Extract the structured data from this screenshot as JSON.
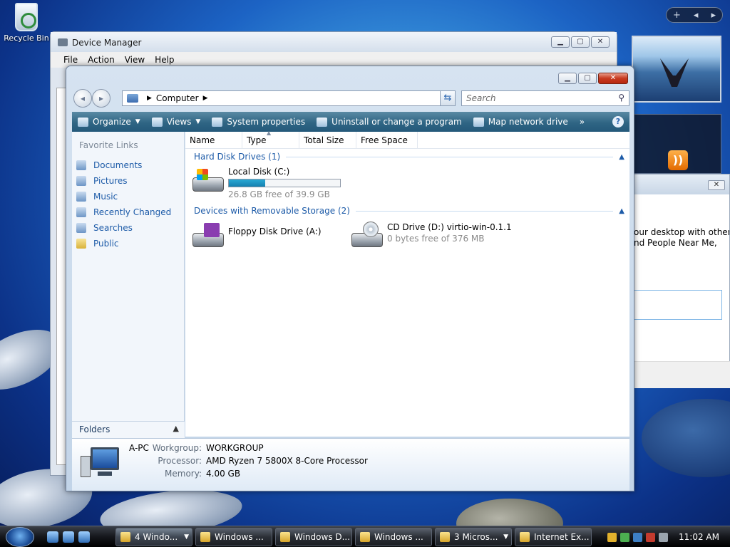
{
  "desktop": {
    "recycle_bin_label": "Recycle Bin"
  },
  "gadgets": {
    "add": "+",
    "prev": "◂",
    "next": "▸"
  },
  "bg_dialog": {
    "close": "✕",
    "line1": "our desktop with other",
    "line2": "nd People Near Me,"
  },
  "device_manager": {
    "title": "Device Manager",
    "menu": [
      "File",
      "Action",
      "View",
      "Help"
    ]
  },
  "explorer": {
    "address": {
      "crumb": "Computer"
    },
    "search_placeholder": "Search",
    "toolbar": {
      "organize": "Organize",
      "views": "Views",
      "system_properties": "System properties",
      "uninstall": "Uninstall or change a program",
      "map_network_drive": "Map network drive",
      "more": "»"
    },
    "nav_pane": {
      "header": "Favorite Links",
      "links": [
        "Documents",
        "Pictures",
        "Music",
        "Recently Changed",
        "Searches",
        "Public"
      ],
      "folders": "Folders"
    },
    "columns": [
      "Name",
      "Type",
      "Total Size",
      "Free Space"
    ],
    "groups": [
      {
        "title": "Hard Disk Drives (1)",
        "items": [
          {
            "name": "Local Disk (C:)",
            "free_text": "26.8 GB free of 39.9 GB",
            "used_fraction": 0.33
          }
        ]
      },
      {
        "title": "Devices with Removable Storage (2)",
        "items": [
          {
            "name": "Floppy Disk Drive (A:)"
          },
          {
            "name": "CD Drive (D:) virtio-win-0.1.1",
            "free_text": "0 bytes free of 376 MB"
          }
        ]
      }
    ],
    "details": {
      "computer_name": "A-PC",
      "workgroup_label": "Workgroup:",
      "workgroup": "WORKGROUP",
      "processor_label": "Processor:",
      "processor": "AMD Ryzen 7 5800X 8-Core Processor",
      "memory_label": "Memory:",
      "memory": "4.00 GB"
    }
  },
  "taskbar": {
    "tasks": [
      {
        "label": "4 Windo...",
        "grouped": true
      },
      {
        "label": "Windows ...",
        "grouped": false
      },
      {
        "label": "Windows D...",
        "grouped": false
      },
      {
        "label": "Windows ...",
        "grouped": false
      },
      {
        "label": "3 Micros...",
        "grouped": true
      },
      {
        "label": "Internet Ex...",
        "grouped": false
      }
    ],
    "clock": "11:02 AM"
  }
}
